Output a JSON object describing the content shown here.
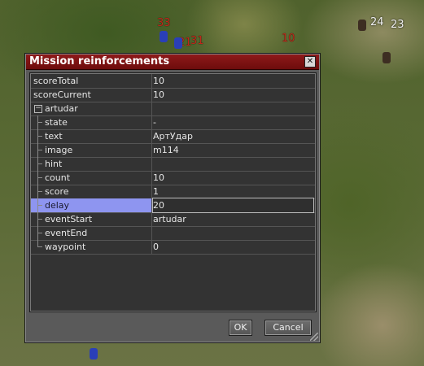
{
  "scene": {
    "floating_numbers": [
      "33",
      "21",
      "31",
      "10",
      "24",
      "23"
    ]
  },
  "dialog": {
    "title": "Mission reinforcements",
    "close_glyph": "✕",
    "rows": [
      {
        "key": "scoreTotal",
        "value": "10",
        "indent": 0
      },
      {
        "key": "scoreCurrent",
        "value": "10",
        "indent": 0
      },
      {
        "key": "artudar",
        "value": "",
        "indent": 0,
        "expander": "−"
      },
      {
        "key": "state",
        "value": "-",
        "indent": 1
      },
      {
        "key": "text",
        "value": "АртУдар",
        "indent": 1
      },
      {
        "key": "image",
        "value": "m114",
        "indent": 1
      },
      {
        "key": "hint",
        "value": "",
        "indent": 1
      },
      {
        "key": "count",
        "value": "10",
        "indent": 1
      },
      {
        "key": "score",
        "value": "1",
        "indent": 1
      },
      {
        "key": "delay",
        "value": "20",
        "indent": 1,
        "selected": true
      },
      {
        "key": "eventStart",
        "value": "artudar",
        "indent": 1
      },
      {
        "key": "eventEnd",
        "value": "",
        "indent": 1
      },
      {
        "key": "waypoint",
        "value": "0",
        "indent": 1
      }
    ],
    "ok_label": "OK",
    "cancel_label": "Cancel"
  }
}
